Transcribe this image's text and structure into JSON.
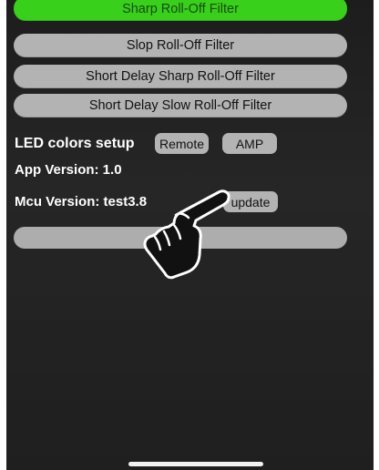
{
  "filters": {
    "items": [
      {
        "label": "Sharp Roll-Off Filter",
        "selected": true
      },
      {
        "label": "Slop Roll-Off Filter",
        "selected": false
      },
      {
        "label": "Short Delay Sharp Roll-Off Filter",
        "selected": false
      },
      {
        "label": "Short Delay Slow Roll-Off Filter",
        "selected": false
      }
    ]
  },
  "led": {
    "label": "LED colors setup",
    "remote_label": "Remote",
    "amp_label": "AMP"
  },
  "versions": {
    "app_version": "App Version: 1.0",
    "mcu_version": "Mcu Version: test3.8",
    "update_label": "update"
  },
  "colors": {
    "selected_filter": "#38d01a",
    "button_gray": "#b3b3b3",
    "background": "#222222"
  },
  "icons": {
    "pointer": "pointing-hand-icon"
  }
}
